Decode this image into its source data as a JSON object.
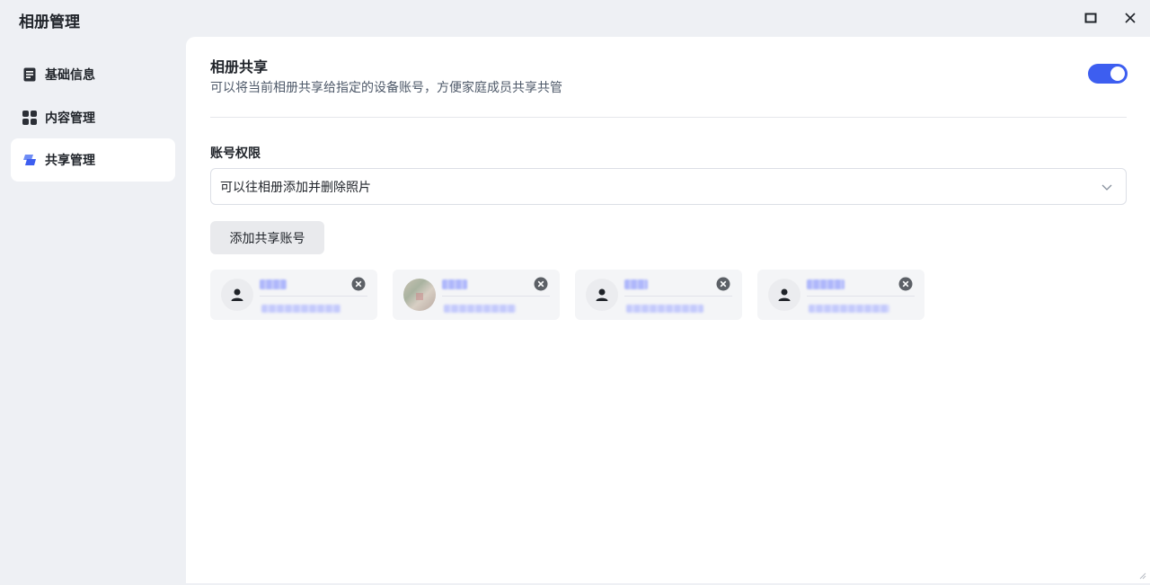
{
  "window": {
    "title": "相册管理",
    "maximize_icon": "maximize-icon",
    "close_icon": "close-icon"
  },
  "sidebar": {
    "items": [
      {
        "label": "基础信息",
        "icon": "document-icon",
        "active": false
      },
      {
        "label": "内容管理",
        "icon": "grid-icon",
        "active": false
      },
      {
        "label": "共享管理",
        "icon": "share-icon",
        "active": true
      }
    ]
  },
  "sharing": {
    "title": "相册共享",
    "description": "可以将当前相册共享给指定的设备账号，方便家庭成员共享共管",
    "enabled": true
  },
  "permission": {
    "label": "账号权限",
    "selected": "可以往相册添加并删除照片"
  },
  "add_account_label": "添加共享账号",
  "accounts": [
    {
      "avatar": "person-icon"
    },
    {
      "avatar": "photo"
    },
    {
      "avatar": "person-icon"
    },
    {
      "avatar": "person-icon"
    }
  ],
  "colors": {
    "accent": "#3d5ef0",
    "background": "#eef0f4",
    "card": "#f4f5f7"
  }
}
